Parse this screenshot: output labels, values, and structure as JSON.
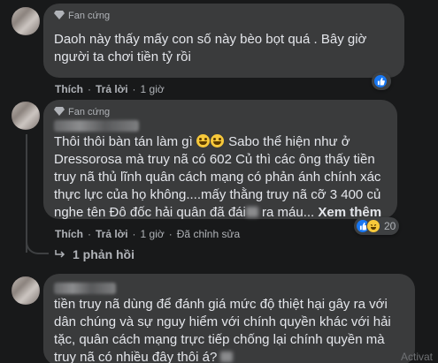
{
  "comments": [
    {
      "badge": "Fan cứng",
      "text": "Daoh này thấy mấy con số này bèo bọt quá . Bây giờ người ta chơi tiền tỷ rồi",
      "actions": {
        "like": "Thích",
        "reply": "Trả lời",
        "time": "1 giờ"
      }
    },
    {
      "badge": "Fan cứng",
      "text_part1": "Thôi thôi bàn tán làm gì ",
      "text_part2": " Sabo thể hiện như ở Dressorosa mà truy nã có 602 Củ thì các ông thấy tiền truy nã thủ lĩnh quân cách mạng có phản ánh chính xác thực lực của họ không....mấy thằng truy nã cỡ 3 400 củ nghe tên Đô đốc hải quân đã đái",
      "text_part3": " ra máu... ",
      "see_more": "Xem thêm",
      "actions": {
        "like": "Thích",
        "reply": "Trả lời",
        "time": "1 giờ",
        "edited": "Đã chỉnh sửa"
      },
      "reactions": {
        "count": "20",
        "icons": [
          "like-icon",
          "haha-icon"
        ]
      }
    },
    {
      "text": "tiền truy nã dùng để đánh giá mức độ thiệt hại gây ra với dân chúng và sự nguy hiểm với chính quyền khác với hải tặc, quân cách mạng trực tiếp chống lại chính quyền mà truy nã có nhiều đây thôi á?"
    }
  ],
  "replies_link": "1 phản hồi",
  "watermark": "Activat",
  "colors": {
    "background": "#18191a",
    "bubble": "#3a3b3c",
    "like_blue": "#1877f2",
    "haha_yellow": "#f7c83a"
  }
}
